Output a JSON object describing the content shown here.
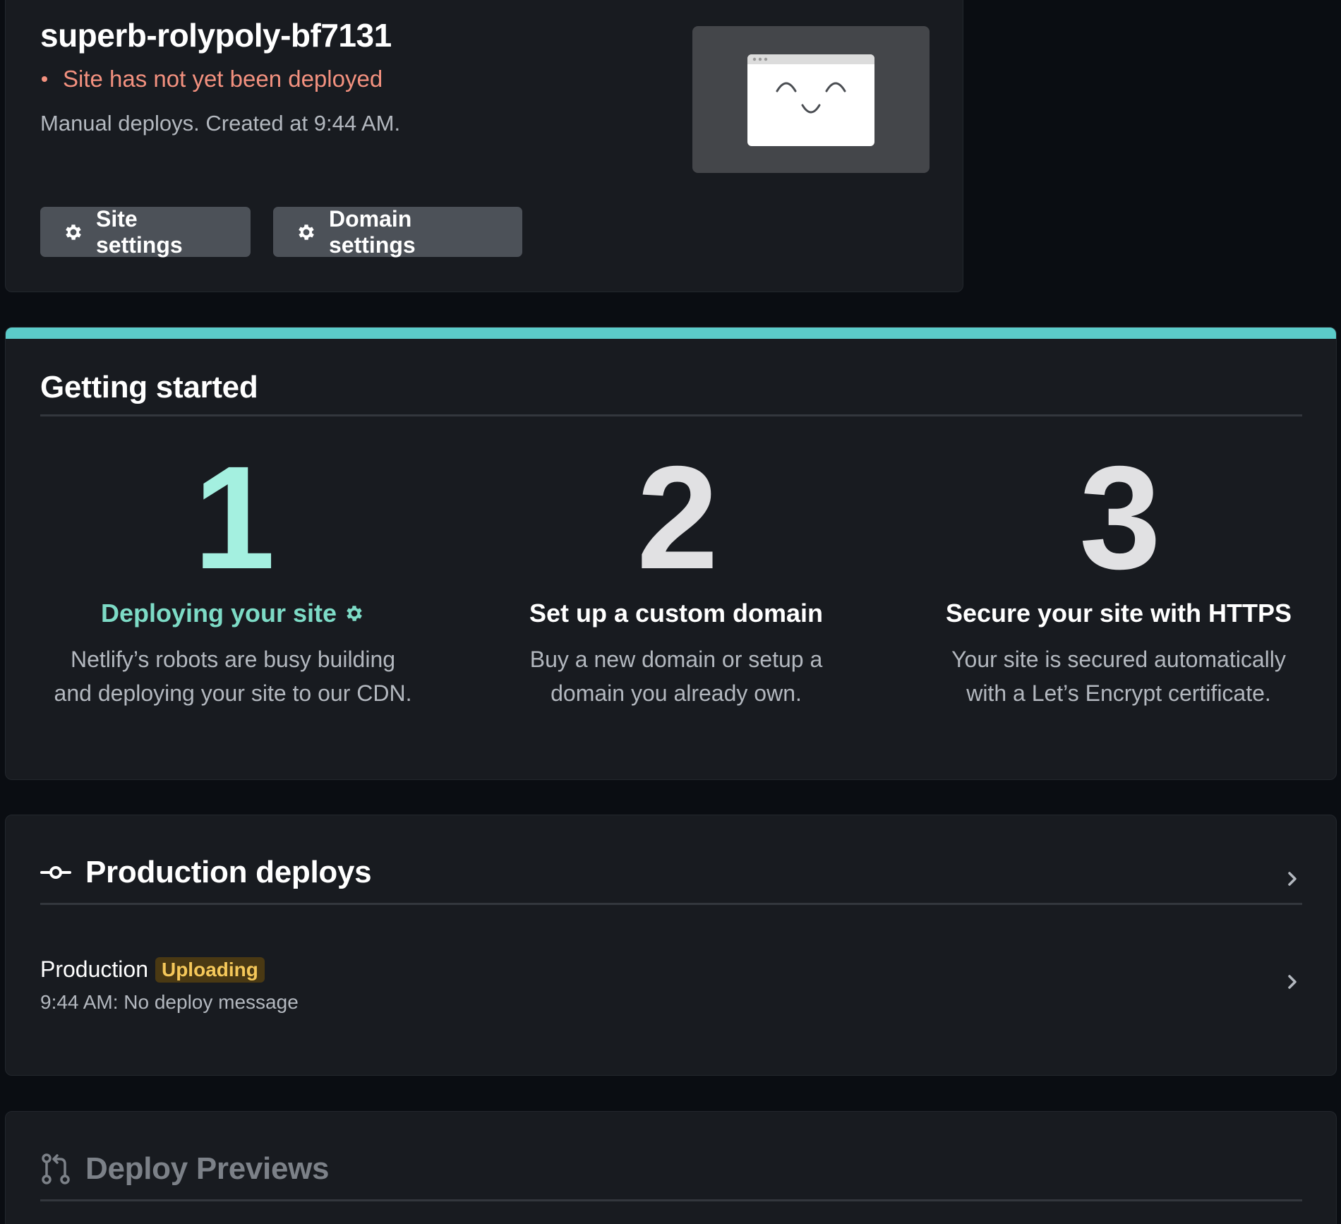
{
  "site": {
    "name": "superb-rolypoly-bf7131",
    "status": "Site has not yet been deployed",
    "meta": "Manual deploys. Created at 9:44 AM.",
    "buttons": {
      "site_settings": "Site settings",
      "domain_settings": "Domain settings"
    }
  },
  "getting_started": {
    "title": "Getting started",
    "steps": [
      {
        "number": "1",
        "title": "Deploying your site",
        "desc_line1": "Netlify’s robots are busy building",
        "desc_line2": "and deploying your site to our CDN.",
        "active": true
      },
      {
        "number": "2",
        "title": "Set up a custom domain",
        "desc_line1": "Buy a new domain or setup a",
        "desc_line2": "domain you already own.",
        "active": false
      },
      {
        "number": "3",
        "title": "Secure your site with HTTPS",
        "desc_line1": "Your site is secured automatically",
        "desc_line2": "with a Let’s Encrypt certificate.",
        "active": false
      }
    ]
  },
  "production_deploys": {
    "title": "Production deploys",
    "deploy": {
      "name": "Production",
      "badge": "Uploading",
      "message": "9:44 AM: No deploy message"
    }
  },
  "deploy_previews": {
    "title": "Deploy Previews"
  },
  "colors": {
    "accent_bar": "#5bcbc9",
    "step_active": "#a4f0e0",
    "status_error": "#f3917f",
    "badge_bg": "#4a3913",
    "badge_text": "#f5c85a"
  },
  "icons": {
    "settings": "gear-icon",
    "deploying": "gear-icon",
    "production": "git-commit-icon",
    "previews": "git-pull-request-icon",
    "navigate": "chevron-right-icon"
  }
}
